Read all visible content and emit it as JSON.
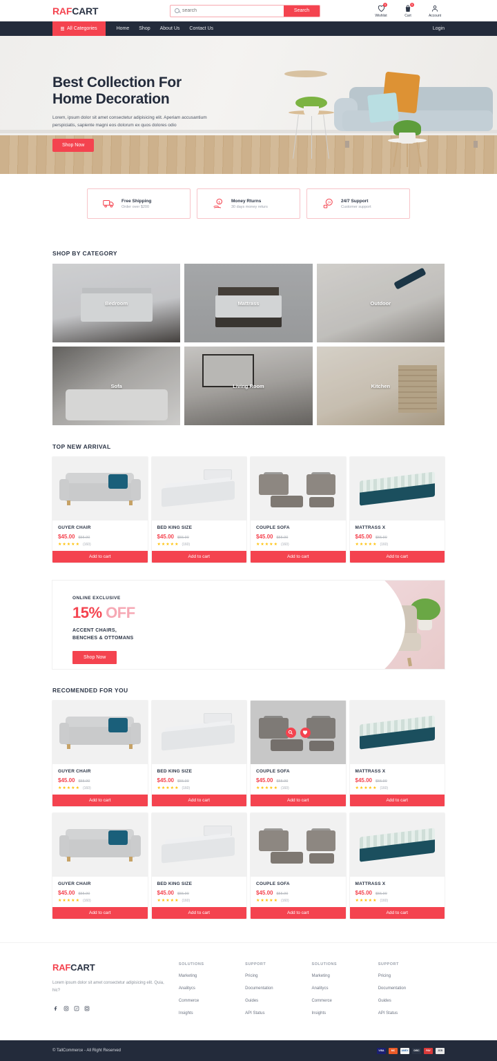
{
  "header": {
    "brand_first": "RAF",
    "brand_second": "CART",
    "search": {
      "placeholder": "search",
      "value": "",
      "button_label": "Search"
    },
    "icons": [
      {
        "name": "wishlist",
        "label": "Wishlist",
        "badge": "0"
      },
      {
        "name": "cart",
        "label": "Cart",
        "badge": "0"
      },
      {
        "name": "account",
        "label": "Account",
        "badge": ""
      }
    ]
  },
  "nav": {
    "all_categories": "All Categories",
    "links": [
      "Home",
      "Shop",
      "About Us",
      "Contact Us"
    ],
    "login": "Login"
  },
  "hero": {
    "title_line1": "Best Collection For",
    "title_line2": "Home Decoration",
    "paragraph": "Lorem, ipsum dolor sit amet consectetur adipisicing elit. Aperiam accusantium perspiciatis, sapiente magni eos dolorum ex quos dolores odio",
    "cta": "Shop Now"
  },
  "features": [
    {
      "icon": "truck-icon",
      "title": "Free Shipping",
      "subtitle": "Order over $200"
    },
    {
      "icon": "money-hand-icon",
      "title": "Money Rturns",
      "subtitle": "30 days money returs"
    },
    {
      "icon": "support-24-icon",
      "title": "24/7 Support",
      "subtitle": "Customer support"
    }
  ],
  "categories": {
    "title": "SHOP BY CATEGORY",
    "items": [
      {
        "label": "Bedroom",
        "art": "c-bedroom"
      },
      {
        "label": "Mattrass",
        "art": "c-mattrass"
      },
      {
        "label": "Outdoor",
        "art": "c-outdoor"
      },
      {
        "label": "Sofa",
        "art": "c-sofa"
      },
      {
        "label": "Living Room",
        "art": "c-living"
      },
      {
        "label": "Kitchen",
        "art": "c-kitchen"
      }
    ]
  },
  "top_new_arrival": {
    "title": "TOP NEW ARRIVAL",
    "products": [
      {
        "name": "GUYER CHAIR",
        "price": "$45.00",
        "old_price": "$55.90",
        "rating": 5,
        "reviews": "(160)",
        "cta": "Add to cart",
        "art": "a-sofa",
        "hovered": false
      },
      {
        "name": "BED KING SIZE",
        "price": "$45.00",
        "old_price": "$55.90",
        "rating": 5,
        "reviews": "(160)",
        "cta": "Add to cart",
        "art": "a-bed",
        "hovered": false
      },
      {
        "name": "COUPLE SOFA",
        "price": "$45.00",
        "old_price": "$55.90",
        "rating": 5,
        "reviews": "(160)",
        "cta": "Add to cart",
        "art": "a-couple",
        "hovered": false
      },
      {
        "name": "MATTRASS X",
        "price": "$45.00",
        "old_price": "$55.90",
        "rating": 5,
        "reviews": "(160)",
        "cta": "Add to cart",
        "art": "a-matt",
        "hovered": false
      }
    ]
  },
  "promo": {
    "eyebrow": "ONLINE EXCLUSIVE",
    "discount_number": "15%",
    "discount_word": "OFF",
    "line1": "ACCENT CHAIRS,",
    "line2": "BENCHES & OTTOMANS",
    "cta": "Shop Now"
  },
  "recomended": {
    "title": "RECOMENDED FOR YOU",
    "products": [
      {
        "name": "GUYER CHAIR",
        "price": "$45.00",
        "old_price": "$55.90",
        "rating": 5,
        "reviews": "(160)",
        "cta": "Add to cart",
        "art": "a-sofa",
        "hovered": false
      },
      {
        "name": "BED KING SIZE",
        "price": "$45.00",
        "old_price": "$55.90",
        "rating": 5,
        "reviews": "(160)",
        "cta": "Add to cart",
        "art": "a-bed",
        "hovered": false
      },
      {
        "name": "COUPLE SOFA",
        "price": "$45.00",
        "old_price": "$55.90",
        "rating": 5,
        "reviews": "(160)",
        "cta": "Add to cart",
        "art": "a-couple",
        "hovered": true
      },
      {
        "name": "MATTRASS X",
        "price": "$45.00",
        "old_price": "$55.90",
        "rating": 5,
        "reviews": "(160)",
        "cta": "Add to cart",
        "art": "a-matt",
        "hovered": false
      },
      {
        "name": "GUYER CHAIR",
        "price": "$45.00",
        "old_price": "$55.90",
        "rating": 5,
        "reviews": "(160)",
        "cta": "Add to cart",
        "art": "a-sofa",
        "hovered": false
      },
      {
        "name": "BED KING SIZE",
        "price": "$45.00",
        "old_price": "$55.90",
        "rating": 5,
        "reviews": "(160)",
        "cta": "Add to cart",
        "art": "a-bed",
        "hovered": false
      },
      {
        "name": "COUPLE SOFA",
        "price": "$45.00",
        "old_price": "$55.90",
        "rating": 5,
        "reviews": "(160)",
        "cta": "Add to cart",
        "art": "a-couple",
        "hovered": false
      },
      {
        "name": "MATTRASS X",
        "price": "$45.00",
        "old_price": "$55.90",
        "rating": 5,
        "reviews": "(160)",
        "cta": "Add to cart",
        "art": "a-matt",
        "hovered": false
      }
    ]
  },
  "footer": {
    "brand_first": "RAF",
    "brand_second": "CART",
    "description": "Lorem ipsum dolor sit amet consectetur adipisicing elit. Quia, hic?",
    "social": [
      "facebook-icon",
      "instagram-icon",
      "twitter-icon",
      "dribbble-icon"
    ],
    "columns": [
      {
        "heading": "SOLUTIONS",
        "links": [
          "Marketing",
          "Analitycs",
          "Commerce",
          "Insights"
        ]
      },
      {
        "heading": "SUPPORT",
        "links": [
          "Pricing",
          "Documentation",
          "Guides",
          "API Status"
        ]
      },
      {
        "heading": "SOLUTIONS",
        "links": [
          "Marketing",
          "Analitycs",
          "Commerce",
          "Insights"
        ]
      },
      {
        "heading": "SUPPORT",
        "links": [
          "Pricing",
          "Documentation",
          "Guides",
          "API Status"
        ]
      }
    ],
    "copyright": "© TallCommerce - All Right Reserved",
    "payment_cards": [
      {
        "label": "VISA",
        "bg": "#1a1f71"
      },
      {
        "label": "MC",
        "bg": "#eb5b28"
      },
      {
        "label": "AMEX",
        "bg": "#f4f4f4",
        "fg": "#2b6cb0"
      },
      {
        "label": "DISC",
        "bg": "#2b3445"
      },
      {
        "label": "PAY",
        "bg": "#d93a3a"
      },
      {
        "label": "JCB",
        "bg": "#e8e8e8",
        "fg": "#2b3445"
      }
    ]
  },
  "colors": {
    "accent": "#f4434f",
    "dark": "#232b3b",
    "star": "#ffc107",
    "muted": "#9aa0ab"
  }
}
